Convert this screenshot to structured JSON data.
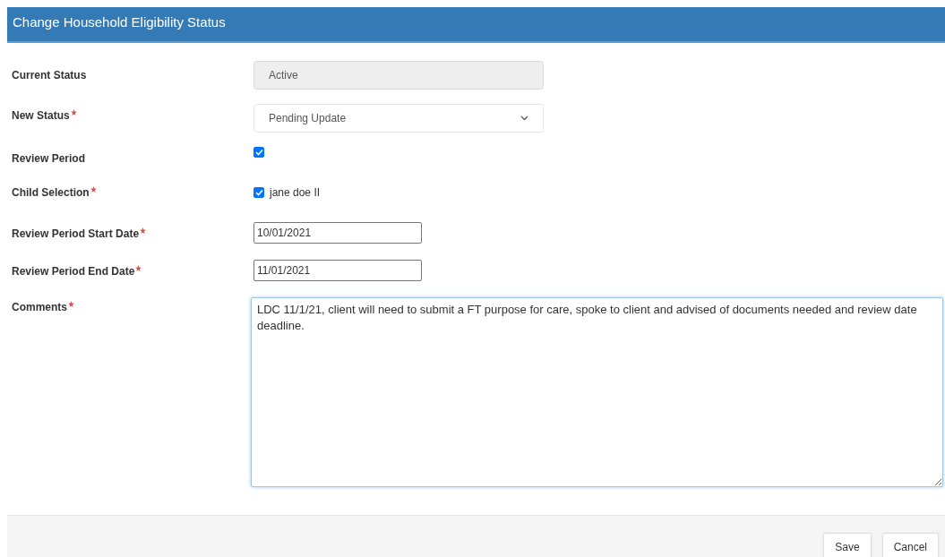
{
  "dialog": {
    "title": "Change Household Eligibility Status"
  },
  "fields": [
    {
      "kind": "readonly",
      "label": "Current Status",
      "required": false,
      "value": "Active"
    },
    {
      "kind": "select",
      "label": "New Status",
      "required": true,
      "value": "Pending Update"
    },
    {
      "kind": "checkbox",
      "label": "Review Period",
      "required": false,
      "checked": true
    },
    {
      "kind": "checkbox",
      "label": "Child Selection",
      "required": true,
      "checked": true,
      "option": "jane doe II"
    },
    {
      "kind": "date",
      "label": "Review Period Start Date",
      "required": true,
      "value": "10/01/2021"
    },
    {
      "kind": "date",
      "label": "Review Period End Date",
      "required": true,
      "value": "11/01/2021"
    },
    {
      "kind": "textarea",
      "label": "Comments",
      "required": true,
      "value": "LDC 11/1/21, client will need to submit a FT purpose for care, spoke to client and advised of documents needed and review date deadline."
    }
  ],
  "buttons": [
    "Save",
    "Cancel"
  ]
}
